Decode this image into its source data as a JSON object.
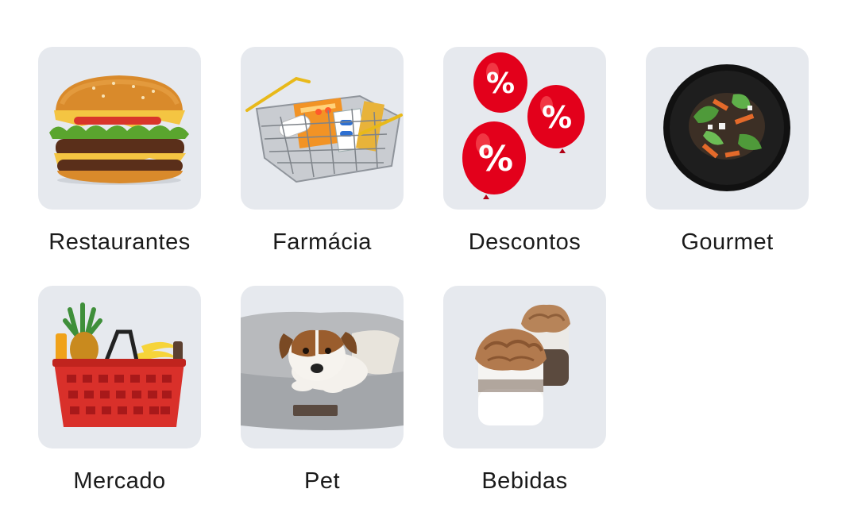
{
  "categories": [
    {
      "label": "Restaurantes",
      "icon": "burger-icon"
    },
    {
      "label": "Farmácia",
      "icon": "pharmacy-basket-icon"
    },
    {
      "label": "Descontos",
      "icon": "discount-balloons-icon"
    },
    {
      "label": "Gourmet",
      "icon": "gourmet-plate-icon"
    },
    {
      "label": "Mercado",
      "icon": "grocery-basket-icon"
    },
    {
      "label": "Pet",
      "icon": "pet-dog-icon"
    },
    {
      "label": "Bebidas",
      "icon": "coffee-drinks-icon"
    }
  ],
  "colors": {
    "tile_background": "#e6e9ee",
    "text": "#1a1a1a",
    "accent_red": "#e3001b"
  }
}
